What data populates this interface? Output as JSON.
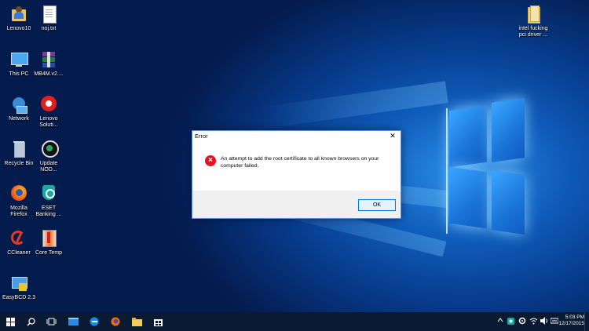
{
  "desktop": {
    "icons": [
      {
        "label": "Lenovo10",
        "icon": "user-folder-icon"
      },
      {
        "label": "noj.txt",
        "icon": "text-file-icon"
      },
      {
        "label": "This PC",
        "icon": "computer-icon"
      },
      {
        "label": "MB4M.v2....",
        "icon": "winrar-archive-icon"
      },
      {
        "label": "Network",
        "icon": "network-icon"
      },
      {
        "label": "Lenovo\nSoluti...",
        "icon": "lenovo-solution-icon"
      },
      {
        "label": "Recycle Bin",
        "icon": "recycle-bin-icon"
      },
      {
        "label": "Update\nNOD...",
        "icon": "eset-update-icon"
      },
      {
        "label": "Mozilla\nFirefox",
        "icon": "firefox-icon"
      },
      {
        "label": "ESET\nBanking ...",
        "icon": "eset-banking-icon"
      },
      {
        "label": "CCleaner",
        "icon": "ccleaner-icon"
      },
      {
        "label": "Core Temp",
        "icon": "core-temp-icon"
      },
      {
        "label": "EasyBCD 2.3",
        "icon": "easybcd-icon"
      },
      {
        "label": "intel fucking\npci driver ...",
        "icon": "folder-icon"
      }
    ]
  },
  "dialog": {
    "title": "Error",
    "close_glyph": "✕",
    "message": "An attempt to add the root certificate to all known browsers on your computer failed.",
    "ok_label": "OK",
    "icon": "error-icon"
  },
  "taskbar": {
    "clock_time": "5:03 PM",
    "clock_date": "12/17/2015",
    "pinned": [
      "start-icon",
      "search-icon",
      "task-view-icon",
      "file-explorer-icon",
      "edge-icon",
      "firefox-icon",
      "folder-icon",
      "store-icon"
    ]
  },
  "colors": {
    "accent": "#0078d7",
    "error": "#e81123",
    "taskbar": "#0b1a33"
  }
}
